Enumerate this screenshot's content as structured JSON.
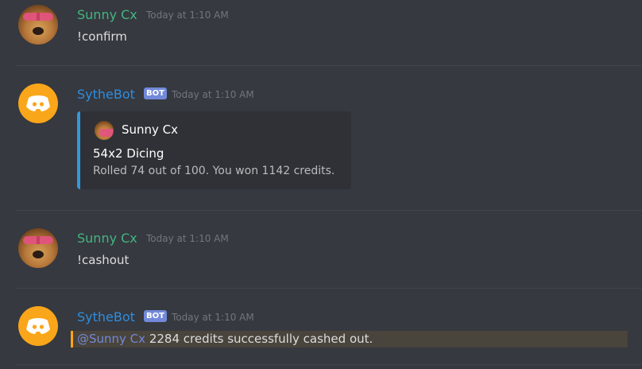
{
  "messages": [
    {
      "author": "Sunny Cx",
      "timestamp": "Today at 1:10 AM",
      "text": "!confirm"
    },
    {
      "author": "SytheBot",
      "bot_tag": "BOT",
      "timestamp": "Today at 1:10 AM",
      "embed": {
        "author": "Sunny Cx",
        "title": "54x2 Dicing",
        "description": "Rolled 74 out of 100. You won 1142 credits."
      }
    },
    {
      "author": "Sunny Cx",
      "timestamp": "Today at 1:10 AM",
      "text": "!cashout"
    },
    {
      "author": "SytheBot",
      "bot_tag": "BOT",
      "timestamp": "Today at 1:10 AM",
      "mention": "@Sunny Cx",
      "text": " 2284 credits successfully cashed out."
    }
  ],
  "colors": {
    "background": "#36393f",
    "user_green": "#43b581",
    "bot_blue": "#2e8de0",
    "bot_tag": "#7289da",
    "embed_bar": "#3498db",
    "mention_bar": "#faa61a"
  },
  "icons": {
    "user_avatar": "dog-with-goggles-avatar",
    "bot_avatar": "discord-logo-avatar"
  }
}
